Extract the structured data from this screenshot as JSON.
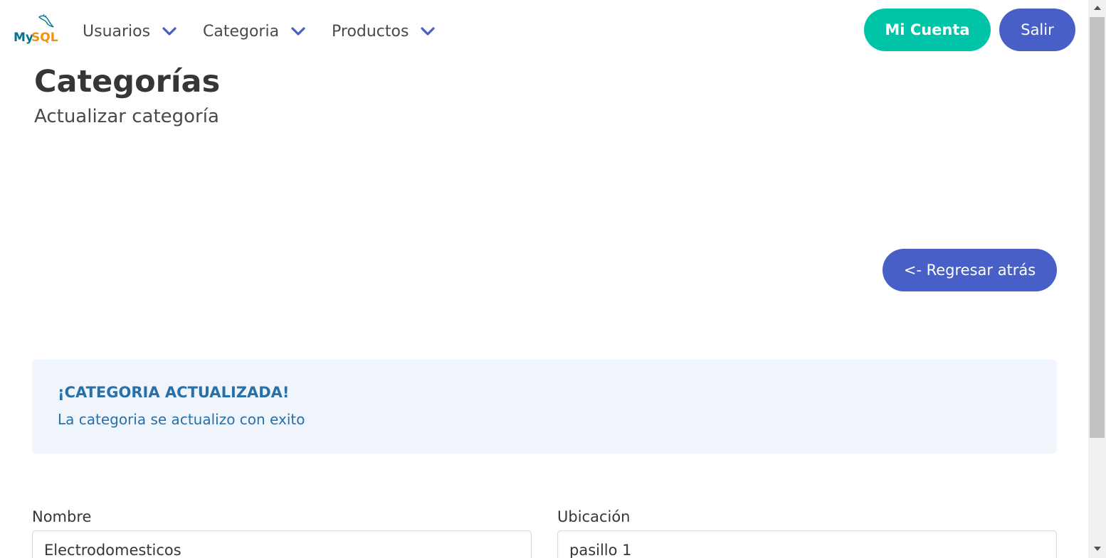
{
  "nav": {
    "logo_text": "MySQL",
    "items": [
      {
        "label": "Usuarios",
        "icon": "chevron-down-icon"
      },
      {
        "label": "Categoria",
        "icon": "chevron-down-icon"
      },
      {
        "label": "Productos",
        "icon": "chevron-down-icon"
      }
    ],
    "account_label": "Mi Cuenta",
    "logout_label": "Salir"
  },
  "header": {
    "title": "Categorías",
    "subtitle": "Actualizar categoría"
  },
  "back_button": {
    "label": "<- Regresar atrás"
  },
  "notification": {
    "title": "¡CATEGORIA ACTUALIZADA!",
    "message": "La categoria se actualizo con exito"
  },
  "form": {
    "nombre_label": "Nombre",
    "nombre_value": "Electrodomesticos",
    "ubicacion_label": "Ubicación",
    "ubicacion_value": "pasillo 1"
  },
  "colors": {
    "primary": "#485fc7",
    "success": "#00c4a7",
    "info_bg": "#eff5fb",
    "info_text": "#296fa8"
  }
}
